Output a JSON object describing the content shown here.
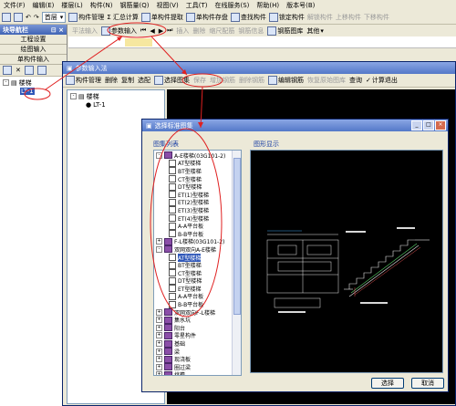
{
  "menubar": [
    "文件(F)",
    "编辑(E)",
    "楼层(L)",
    "构件(N)",
    "钢筋量(Q)",
    "视图(V)",
    "工具(T)",
    "在线服务(S)",
    "帮助(H)",
    "版本号(B)"
  ],
  "toolbar": {
    "floor": "首层",
    "items": [
      "构件管理",
      "Σ 汇总计算",
      "单构件提取",
      "单构件存盘",
      "查找构件",
      "锁定构件",
      "解锁构件",
      "上移构件",
      "下移构件"
    ],
    "param_input": "参数输入"
  },
  "toolbar2": [
    "平法输入",
    "插入",
    "删除",
    "缩尺配筋",
    "钢筋信息",
    "钢筋图库",
    "其他"
  ],
  "nav": {
    "title": "块导航栏",
    "buttons": [
      "工程设置",
      "绘图输入",
      "单构件输入"
    ],
    "tree_root": "楼梯",
    "tree_child": "LT-1"
  },
  "param_window": {
    "title": "参数输入法",
    "toolbar": [
      "构件管理",
      "删除",
      "复制",
      "选配",
      "选择图集",
      "保存",
      "增加钢筋",
      "删除钢筋",
      "编辑钢筋",
      "恢复原始图库",
      "查询",
      "计算退出"
    ],
    "tree_root": "楼梯",
    "tree_child": "LT-1"
  },
  "dialog": {
    "title": "选择标准图集",
    "list_label": "图集列表",
    "preview_label": "图形显示",
    "items": [
      {
        "text": "A-E楼梯(03G101-2)",
        "kind": "book",
        "indent": 0,
        "expander": "-"
      },
      {
        "text": "AT型楼梯",
        "kind": "doc",
        "indent": 1
      },
      {
        "text": "BT型楼梯",
        "kind": "doc",
        "indent": 1
      },
      {
        "text": "CT型楼梯",
        "kind": "doc",
        "indent": 1
      },
      {
        "text": "DT型楼梯",
        "kind": "doc",
        "indent": 1
      },
      {
        "text": "ET(1)型楼梯",
        "kind": "doc",
        "indent": 1
      },
      {
        "text": "ET(2)型楼梯",
        "kind": "doc",
        "indent": 1
      },
      {
        "text": "ET(3)型楼梯",
        "kind": "doc",
        "indent": 1
      },
      {
        "text": "ET(4)型楼梯",
        "kind": "doc",
        "indent": 1
      },
      {
        "text": "A-A平台板",
        "kind": "doc",
        "indent": 1
      },
      {
        "text": "B-B平台板",
        "kind": "doc",
        "indent": 1
      },
      {
        "text": "F-L楼梯(03G101-2)",
        "kind": "book",
        "indent": 0,
        "expander": "+"
      },
      {
        "text": "双网双向A-E楼梯",
        "kind": "book",
        "indent": 0,
        "expander": "-"
      },
      {
        "text": "AT型楼梯",
        "kind": "doc",
        "indent": 1,
        "selected": true
      },
      {
        "text": "BT型楼梯",
        "kind": "doc",
        "indent": 1
      },
      {
        "text": "CT型楼梯",
        "kind": "doc",
        "indent": 1
      },
      {
        "text": "DT型楼梯",
        "kind": "doc",
        "indent": 1
      },
      {
        "text": "ET型楼梯",
        "kind": "doc",
        "indent": 1
      },
      {
        "text": "A-A平台板",
        "kind": "doc",
        "indent": 1
      },
      {
        "text": "B-B平台板",
        "kind": "doc",
        "indent": 1
      },
      {
        "text": "双网双向F-L楼梯",
        "kind": "book",
        "indent": 0,
        "expander": "+"
      },
      {
        "text": "集水坑",
        "kind": "book",
        "indent": 0,
        "expander": "+"
      },
      {
        "text": "阳台",
        "kind": "book",
        "indent": 0,
        "expander": "+"
      },
      {
        "text": "零星构件",
        "kind": "book",
        "indent": 0,
        "expander": "+"
      },
      {
        "text": "基础",
        "kind": "book",
        "indent": 0,
        "expander": "+"
      },
      {
        "text": "梁",
        "kind": "book",
        "indent": 0,
        "expander": "+"
      },
      {
        "text": "现浇板",
        "kind": "book",
        "indent": 0,
        "expander": "+"
      },
      {
        "text": "圈过梁",
        "kind": "book",
        "indent": 0,
        "expander": "+"
      },
      {
        "text": "挑檐",
        "kind": "book",
        "indent": 0,
        "expander": "+"
      }
    ],
    "buttons": {
      "select": "选择",
      "cancel": "取消"
    }
  },
  "colors": {
    "annotation": "#e02020",
    "selection": "#2f57b8",
    "titlebar": "#5478c8"
  }
}
